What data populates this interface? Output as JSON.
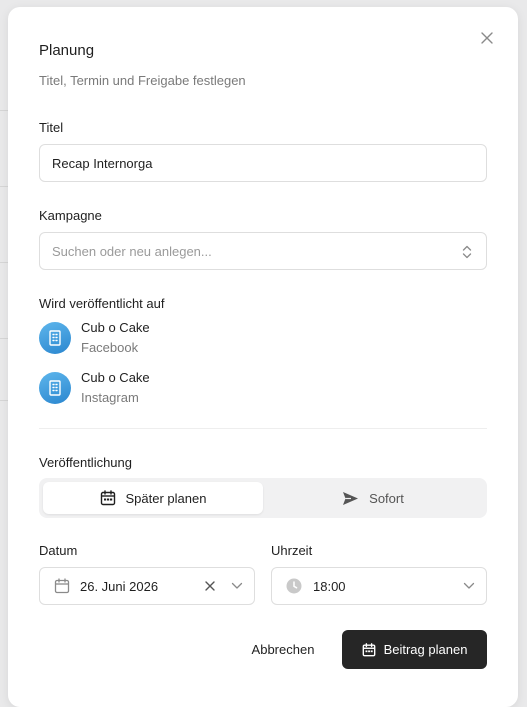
{
  "dialog": {
    "title": "Planung",
    "subtitle": "Titel, Termin und Freigabe festlegen",
    "close_icon": "close-icon"
  },
  "title_field": {
    "label": "Titel",
    "value": "Recap Internorga"
  },
  "campaign_field": {
    "label": "Kampagne",
    "placeholder": "Suchen oder neu anlegen..."
  },
  "publish_on": {
    "label": "Wird veröffentlicht auf",
    "accounts": [
      {
        "name": "Cub o Cake",
        "network": "Facebook",
        "icon": "building-icon"
      },
      {
        "name": "Cub o Cake",
        "network": "Instagram",
        "icon": "building-icon"
      }
    ]
  },
  "publication": {
    "label": "Veröffentlichung",
    "options": [
      {
        "label": "Später planen",
        "icon": "calendar-icon",
        "selected": true
      },
      {
        "label": "Sofort",
        "icon": "send-icon",
        "selected": false
      }
    ]
  },
  "date_field": {
    "label": "Datum",
    "value": "26. Juni 2026"
  },
  "time_field": {
    "label": "Uhrzeit",
    "value": "18:00"
  },
  "actions": {
    "cancel_label": "Abbrechen",
    "submit_label": "Beitrag planen"
  },
  "colors": {
    "primary": "#262626",
    "avatar": "#3a97d9",
    "muted_text": "#7a7a7a"
  }
}
